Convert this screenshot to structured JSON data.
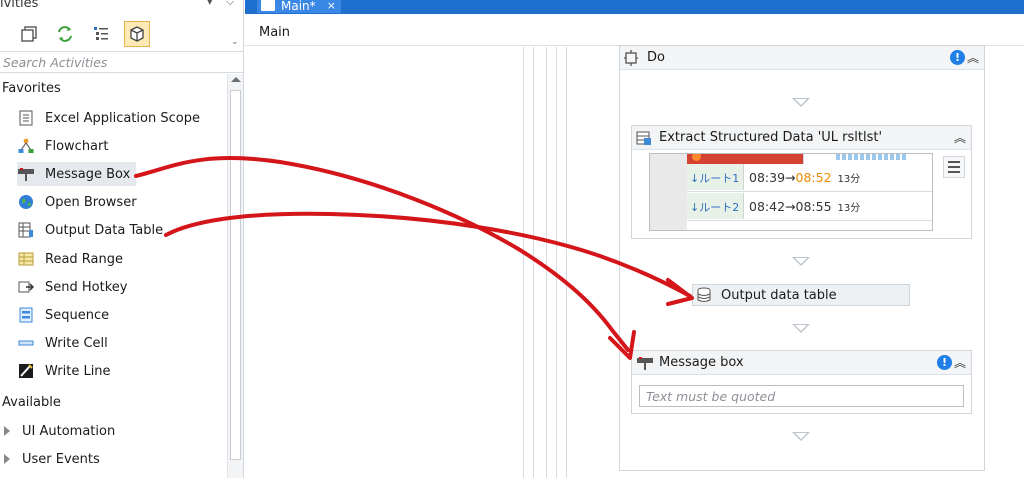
{
  "activities_panel": {
    "title": "ivities",
    "pin": "⌵",
    "close": "×",
    "search_placeholder": "Search Activities",
    "favorites_label": "Favorites",
    "available_label": "Available",
    "favorites": [
      {
        "label": "Excel Application Scope",
        "icon": "excel-scope-icon"
      },
      {
        "label": "Flowchart",
        "icon": "flowchart-icon"
      },
      {
        "label": "Message Box",
        "icon": "message-box-icon"
      },
      {
        "label": "Open Browser",
        "icon": "globe-icon"
      },
      {
        "label": "Output Data Table",
        "icon": "data-table-icon"
      },
      {
        "label": "Read Range",
        "icon": "read-range-icon"
      },
      {
        "label": "Send Hotkey",
        "icon": "hotkey-icon"
      },
      {
        "label": "Sequence",
        "icon": "sequence-icon"
      },
      {
        "label": "Write Cell",
        "icon": "write-cell-icon"
      },
      {
        "label": "Write Line",
        "icon": "write-line-icon"
      }
    ],
    "available": [
      {
        "label": "UI Automation"
      },
      {
        "label": "User Events"
      }
    ]
  },
  "designer": {
    "tab_label": "Main*",
    "tab_close": "×",
    "breadcrumb": "Main",
    "do_title": "Do",
    "esd_title": "Extract Structured Data 'UL  rsltlst'",
    "esd_rows": [
      {
        "route": "↓ルート1",
        "depart": "08:39→",
        "arrive": "08:52",
        "duration": "13分"
      },
      {
        "route": "↓ルート2",
        "depart": "08:42→",
        "arrive": "08:55",
        "duration": "13分"
      }
    ],
    "output_title": "Output data table",
    "message_title": "Message box",
    "message_placeholder": "Text must be quoted",
    "info_mark": "!",
    "collapse": "⌃"
  },
  "colors": {
    "tab_bar": "#1f6fcf",
    "annotation": "#d4161a",
    "info": "#1f7fe6",
    "arrive_highlight": "#f08a00"
  }
}
